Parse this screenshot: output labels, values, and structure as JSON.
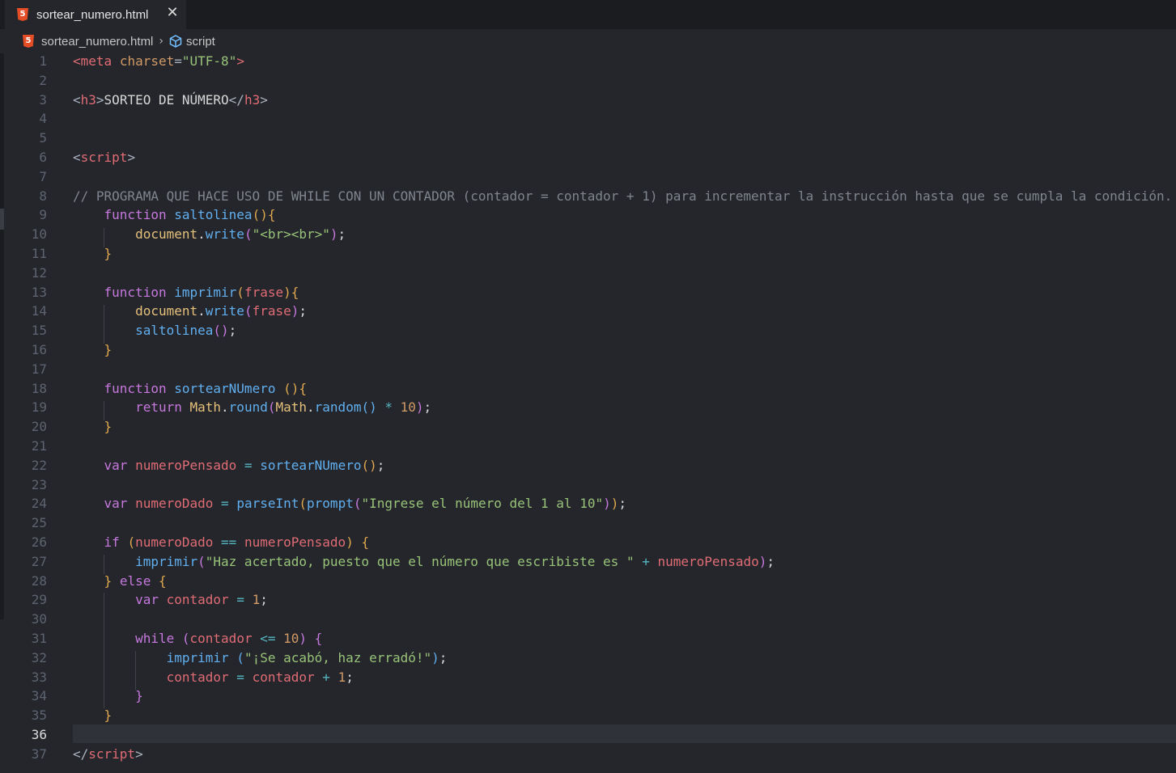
{
  "tab": {
    "icon_glyph": "5",
    "title": "sortear_numero.html",
    "close_glyph": "✕"
  },
  "breadcrumb": {
    "icon_glyph": "5",
    "file": "sortear_numero.html",
    "separator": "›",
    "symbol": "script"
  },
  "editor": {
    "active_line": 36,
    "lines": [
      {
        "n": "1",
        "tokens": [
          [
            "tg",
            "<"
          ],
          [
            "tg",
            "meta"
          ],
          [
            "tx",
            " "
          ],
          [
            "at",
            "charset"
          ],
          [
            "pu",
            "="
          ],
          [
            "st",
            "\"UTF-8\""
          ],
          [
            "tg",
            ">"
          ]
        ]
      },
      {
        "n": "2",
        "tokens": []
      },
      {
        "n": "3",
        "tokens": [
          [
            "pu",
            "<"
          ],
          [
            "tg",
            "h3"
          ],
          [
            "pu",
            ">"
          ],
          [
            "tx",
            "SORTEO DE NÚMERO"
          ],
          [
            "pu",
            "</"
          ],
          [
            "tg",
            "h3"
          ],
          [
            "pu",
            ">"
          ]
        ]
      },
      {
        "n": "4",
        "tokens": []
      },
      {
        "n": "5",
        "tokens": []
      },
      {
        "n": "6",
        "tokens": [
          [
            "pu",
            "<"
          ],
          [
            "tg",
            "script"
          ],
          [
            "pu",
            ">"
          ]
        ]
      },
      {
        "n": "7",
        "tokens": []
      },
      {
        "n": "8",
        "tokens": [
          [
            "cm",
            "// PROGRAMA QUE HACE USO DE WHILE CON UN CONTADOR (contador = contador + 1) para incrementar la instrucción hasta que se cumpla la condición."
          ]
        ]
      },
      {
        "n": "9",
        "tokens": [
          [
            "tx",
            "    "
          ],
          [
            "kw",
            "function"
          ],
          [
            "tx",
            " "
          ],
          [
            "fn",
            "saltolinea"
          ],
          [
            "br1",
            "()"
          ],
          [
            "br1",
            "{"
          ]
        ]
      },
      {
        "n": "10",
        "tokens": [
          [
            "tx",
            "        "
          ],
          [
            "ob",
            "document"
          ],
          [
            "tx",
            "."
          ],
          [
            "fn",
            "write"
          ],
          [
            "br2",
            "("
          ],
          [
            "st",
            "\"<br><br>\""
          ],
          [
            "br2",
            ")"
          ],
          [
            "tx",
            ";"
          ]
        ]
      },
      {
        "n": "11",
        "tokens": [
          [
            "tx",
            "    "
          ],
          [
            "br1",
            "}"
          ]
        ]
      },
      {
        "n": "12",
        "tokens": []
      },
      {
        "n": "13",
        "tokens": [
          [
            "tx",
            "    "
          ],
          [
            "kw",
            "function"
          ],
          [
            "tx",
            " "
          ],
          [
            "fn",
            "imprimir"
          ],
          [
            "br1",
            "("
          ],
          [
            "vr",
            "frase"
          ],
          [
            "br1",
            ")"
          ],
          [
            "br1",
            "{"
          ]
        ]
      },
      {
        "n": "14",
        "tokens": [
          [
            "tx",
            "        "
          ],
          [
            "ob",
            "document"
          ],
          [
            "tx",
            "."
          ],
          [
            "fn",
            "write"
          ],
          [
            "br2",
            "("
          ],
          [
            "vr",
            "frase"
          ],
          [
            "br2",
            ")"
          ],
          [
            "tx",
            ";"
          ]
        ]
      },
      {
        "n": "15",
        "tokens": [
          [
            "tx",
            "        "
          ],
          [
            "fn",
            "saltolinea"
          ],
          [
            "br2",
            "()"
          ],
          [
            "tx",
            ";"
          ]
        ]
      },
      {
        "n": "16",
        "tokens": [
          [
            "tx",
            "    "
          ],
          [
            "br1",
            "}"
          ]
        ]
      },
      {
        "n": "17",
        "tokens": []
      },
      {
        "n": "18",
        "tokens": [
          [
            "tx",
            "    "
          ],
          [
            "kw",
            "function"
          ],
          [
            "tx",
            " "
          ],
          [
            "fn",
            "sortearNUmero"
          ],
          [
            "tx",
            " "
          ],
          [
            "br1",
            "()"
          ],
          [
            "br1",
            "{"
          ]
        ]
      },
      {
        "n": "19",
        "tokens": [
          [
            "tx",
            "        "
          ],
          [
            "kw",
            "return"
          ],
          [
            "tx",
            " "
          ],
          [
            "ob",
            "Math"
          ],
          [
            "tx",
            "."
          ],
          [
            "fn",
            "round"
          ],
          [
            "br2",
            "("
          ],
          [
            "ob",
            "Math"
          ],
          [
            "tx",
            "."
          ],
          [
            "fn",
            "random"
          ],
          [
            "fn",
            "()"
          ],
          [
            "tx",
            " "
          ],
          [
            "op",
            "*"
          ],
          [
            "tx",
            " "
          ],
          [
            "nm",
            "10"
          ],
          [
            "br2",
            ")"
          ],
          [
            "tx",
            ";"
          ]
        ]
      },
      {
        "n": "20",
        "tokens": [
          [
            "tx",
            "    "
          ],
          [
            "br1",
            "}"
          ]
        ]
      },
      {
        "n": "21",
        "tokens": []
      },
      {
        "n": "22",
        "tokens": [
          [
            "tx",
            "    "
          ],
          [
            "kw",
            "var"
          ],
          [
            "tx",
            " "
          ],
          [
            "vr",
            "numeroPensado"
          ],
          [
            "tx",
            " "
          ],
          [
            "op",
            "="
          ],
          [
            "tx",
            " "
          ],
          [
            "fn",
            "sortearNUmero"
          ],
          [
            "br1",
            "()"
          ],
          [
            "tx",
            ";"
          ]
        ]
      },
      {
        "n": "23",
        "tokens": []
      },
      {
        "n": "24",
        "tokens": [
          [
            "tx",
            "    "
          ],
          [
            "kw",
            "var"
          ],
          [
            "tx",
            " "
          ],
          [
            "vr",
            "numeroDado"
          ],
          [
            "tx",
            " "
          ],
          [
            "op",
            "="
          ],
          [
            "tx",
            " "
          ],
          [
            "fn",
            "parseInt"
          ],
          [
            "br1",
            "("
          ],
          [
            "fn",
            "prompt"
          ],
          [
            "br2",
            "("
          ],
          [
            "st",
            "\"Ingrese el número del 1 al 10\""
          ],
          [
            "br2",
            ")"
          ],
          [
            "br1",
            ")"
          ],
          [
            "tx",
            ";"
          ]
        ]
      },
      {
        "n": "25",
        "tokens": []
      },
      {
        "n": "26",
        "tokens": [
          [
            "tx",
            "    "
          ],
          [
            "kw",
            "if"
          ],
          [
            "tx",
            " "
          ],
          [
            "br1",
            "("
          ],
          [
            "vr",
            "numeroDado"
          ],
          [
            "tx",
            " "
          ],
          [
            "op",
            "=="
          ],
          [
            "tx",
            " "
          ],
          [
            "vr",
            "numeroPensado"
          ],
          [
            "br1",
            ")"
          ],
          [
            "tx",
            " "
          ],
          [
            "br1",
            "{"
          ]
        ]
      },
      {
        "n": "27",
        "tokens": [
          [
            "tx",
            "        "
          ],
          [
            "fn",
            "imprimir"
          ],
          [
            "br2",
            "("
          ],
          [
            "st",
            "\"Haz acertado, puesto que el número que escribiste es \""
          ],
          [
            "tx",
            " "
          ],
          [
            "op",
            "+"
          ],
          [
            "tx",
            " "
          ],
          [
            "vr",
            "numeroPensado"
          ],
          [
            "br2",
            ")"
          ],
          [
            "tx",
            ";"
          ]
        ]
      },
      {
        "n": "28",
        "tokens": [
          [
            "tx",
            "    "
          ],
          [
            "br1",
            "}"
          ],
          [
            "tx",
            " "
          ],
          [
            "kw",
            "else"
          ],
          [
            "tx",
            " "
          ],
          [
            "br1",
            "{"
          ]
        ]
      },
      {
        "n": "29",
        "tokens": [
          [
            "tx",
            "        "
          ],
          [
            "kw",
            "var"
          ],
          [
            "tx",
            " "
          ],
          [
            "vr",
            "contador"
          ],
          [
            "tx",
            " "
          ],
          [
            "op",
            "="
          ],
          [
            "tx",
            " "
          ],
          [
            "nm",
            "1"
          ],
          [
            "tx",
            ";"
          ]
        ]
      },
      {
        "n": "30",
        "tokens": []
      },
      {
        "n": "31",
        "tokens": [
          [
            "tx",
            "        "
          ],
          [
            "kw",
            "while"
          ],
          [
            "tx",
            " "
          ],
          [
            "br2",
            "("
          ],
          [
            "vr",
            "contador"
          ],
          [
            "tx",
            " "
          ],
          [
            "op",
            "<="
          ],
          [
            "tx",
            " "
          ],
          [
            "nm",
            "10"
          ],
          [
            "br2",
            ")"
          ],
          [
            "tx",
            " "
          ],
          [
            "br2",
            "{"
          ]
        ]
      },
      {
        "n": "32",
        "tokens": [
          [
            "tx",
            "            "
          ],
          [
            "fn",
            "imprimir"
          ],
          [
            "tx",
            " "
          ],
          [
            "fn",
            "("
          ],
          [
            "st",
            "\"¡Se acabó, haz erradó!\""
          ],
          [
            "fn",
            ")"
          ],
          [
            "tx",
            ";"
          ]
        ]
      },
      {
        "n": "33",
        "tokens": [
          [
            "tx",
            "            "
          ],
          [
            "vr",
            "contador"
          ],
          [
            "tx",
            " "
          ],
          [
            "op",
            "="
          ],
          [
            "tx",
            " "
          ],
          [
            "vr",
            "contador"
          ],
          [
            "tx",
            " "
          ],
          [
            "op",
            "+"
          ],
          [
            "tx",
            " "
          ],
          [
            "nm",
            "1"
          ],
          [
            "tx",
            ";"
          ]
        ]
      },
      {
        "n": "34",
        "tokens": [
          [
            "tx",
            "        "
          ],
          [
            "br2",
            "}"
          ]
        ]
      },
      {
        "n": "35",
        "tokens": [
          [
            "tx",
            "    "
          ],
          [
            "br1",
            "}"
          ]
        ]
      },
      {
        "n": "36",
        "tokens": []
      },
      {
        "n": "37",
        "tokens": [
          [
            "pu",
            "</"
          ],
          [
            "tg",
            "script"
          ],
          [
            "pu",
            ">"
          ]
        ]
      }
    ]
  }
}
